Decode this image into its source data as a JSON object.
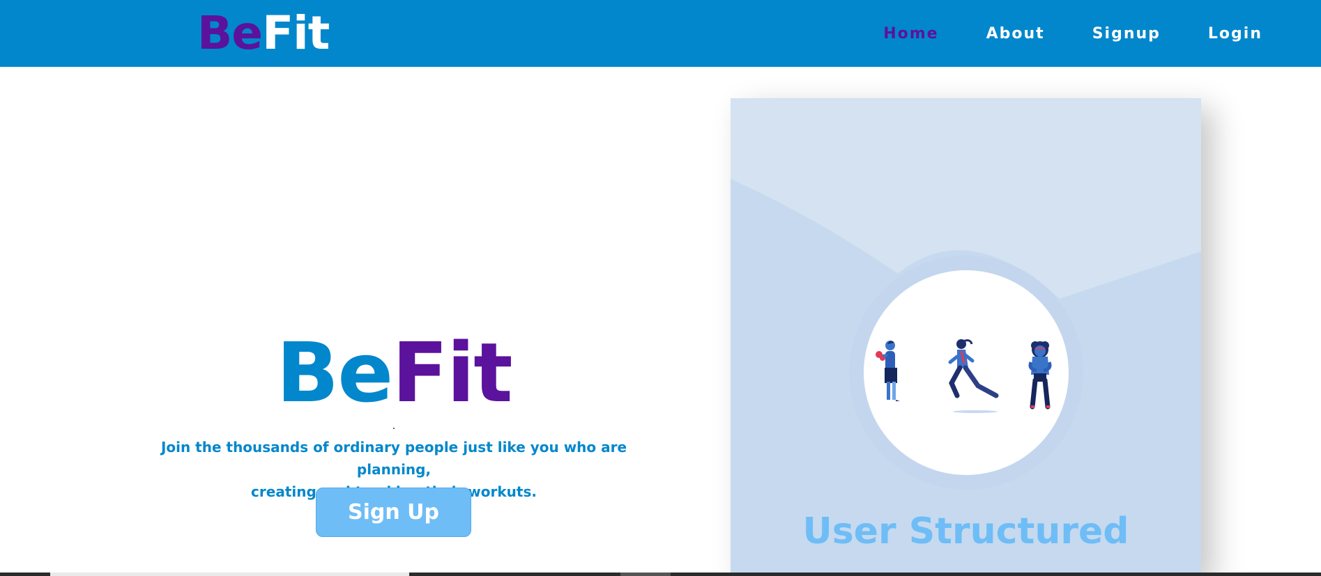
{
  "navbar": {
    "logo": {
      "part_a": "Be",
      "part_b": "Fit"
    },
    "links": [
      {
        "label": "Home",
        "active": true
      },
      {
        "label": "About",
        "active": false
      },
      {
        "label": "Signup",
        "active": false
      },
      {
        "label": "Login",
        "active": false
      }
    ]
  },
  "hero": {
    "title": {
      "part_a": "Be",
      "part_b": "Fit"
    },
    "text_line1": "Join the thousands of ordinary people just like you who are planning,",
    "text_line2": "creating and tracking their workuts.",
    "signup_label": "Sign Up"
  },
  "card": {
    "title": "User Structured",
    "illustration_icons": [
      "boxer-figure-icon",
      "runner-figure-icon",
      "athlete-figure-icon"
    ]
  },
  "colors": {
    "navbar_bg": "#0287CC",
    "brand_purple": "#5B129C",
    "brand_blue": "#0287CC",
    "button_bg": "#6EBDF6",
    "card_bg": "#C6D9EF"
  }
}
